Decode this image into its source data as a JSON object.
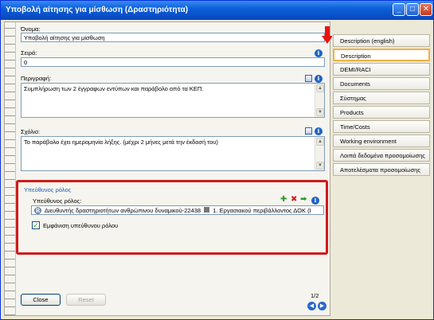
{
  "window": {
    "title": "Υποβολή αίτησης για μίσθωση (Δραστηριότητα)",
    "buttons": {
      "minimize": "_",
      "maximize": "□",
      "close": "✕"
    }
  },
  "form": {
    "name_label": "Όνομα:",
    "name_value": "Υποβολή αίτησης για μίσθωση",
    "order_label": "Σειρά:",
    "order_value": "0",
    "description_label": "Περιγραφή:",
    "description_value": "Συμπλήρωση των 2 έγγραφων εντύπων και παράβολο από τα ΚΕΠ.",
    "comment_label": "Σχόλιο:",
    "comment_value": "Το παράβολο έχει ημερομηνία λήξης. (μέχρι 2 μήνες μετά την έκδοσή του)"
  },
  "responsible": {
    "group_title": "Υπεύθυνος ρόλος",
    "label": "Υπεύθυνος ρόλος:",
    "row_value": "Διευθυντής δραστηριοτήτων ανθρώπινου δυναμικού-22438",
    "row_value_2": "1. Εργασιακού περιβάλλοντος ΔΟΚ (Ι",
    "show_checkbox_label": "Εμφάνιση υπεύθυνου ρόλου",
    "show_checked": true
  },
  "footer": {
    "close_label": "Close",
    "reset_label": "Reset",
    "page": "1/2"
  },
  "tabs": [
    {
      "label": "Description (english)",
      "active": false
    },
    {
      "label": "Description",
      "active": true
    },
    {
      "label": "DEMI/RACI",
      "active": false
    },
    {
      "label": "Documents",
      "active": false
    },
    {
      "label": "Σύστημας",
      "active": false
    },
    {
      "label": "Products",
      "active": false
    },
    {
      "label": "Time/Costs",
      "active": false
    },
    {
      "label": "Working environment",
      "active": false
    },
    {
      "label": "Λοιπά δεδομένα προσομοίωσης",
      "active": false
    },
    {
      "label": "Αποτελέσματα προσομοίωσης",
      "active": false
    }
  ],
  "colors": {
    "highlight_border": "#d01a1a",
    "active_tab_border": "#f3b043",
    "title_bar": "#0c5fd8"
  }
}
